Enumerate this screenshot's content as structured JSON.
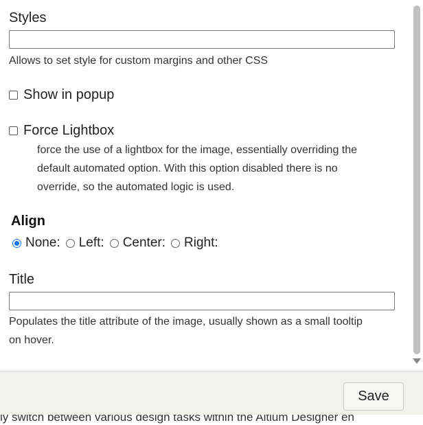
{
  "styles": {
    "label": "Styles",
    "value": "",
    "help": "Allows to set style for custom margins and other CSS"
  },
  "show_in_popup": {
    "label": "Show in popup",
    "checked": false
  },
  "force_lightbox": {
    "label": "Force Lightbox",
    "checked": false,
    "help_lines": [
      "force the use of a lightbox for the image, essentially overriding the",
      "default automated option. With this option disabled there is no",
      "override, so the automated logic is used."
    ]
  },
  "align": {
    "title": "Align",
    "options": [
      "None:",
      "Left:",
      "Center:",
      "Right:"
    ],
    "selected": "None:"
  },
  "title_field": {
    "label": "Title",
    "value": "",
    "help_lines": [
      "Populates the title attribute of the image, usually shown as a small tooltip",
      "on hover."
    ]
  },
  "footer": {
    "save_label": "Save"
  },
  "background_page": {
    "text": "ly switch between various design tasks within the Altium Designer en"
  },
  "colors": {
    "accent": "#1a73e8",
    "footer_bg": "#f1f1ee"
  }
}
